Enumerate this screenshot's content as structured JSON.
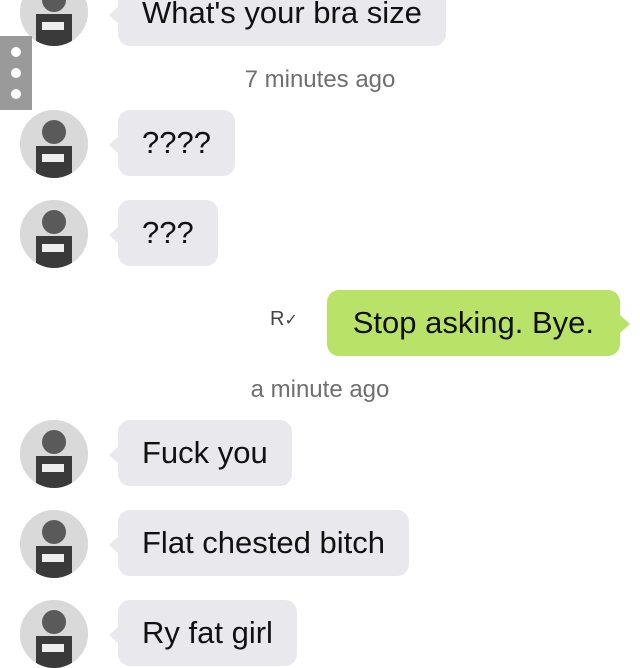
{
  "messages": [
    {
      "type": "received",
      "text": "What's your bra size"
    },
    {
      "type": "timestamp",
      "text": "7 minutes ago"
    },
    {
      "type": "received",
      "text": "????"
    },
    {
      "type": "received",
      "text": "???"
    },
    {
      "type": "sent",
      "text": "Stop asking. Bye.",
      "receipt": "R"
    },
    {
      "type": "timestamp",
      "text": "a minute ago"
    },
    {
      "type": "received",
      "text": "Fuck you"
    },
    {
      "type": "received",
      "text": "Flat chested bitch"
    },
    {
      "type": "received",
      "text": "Ry fat girl"
    }
  ],
  "colors": {
    "received_bubble": "#e8e8ed",
    "sent_bubble": "#b9e268",
    "timestamp_text": "#6f6f6f",
    "menu_tab": "#9a9a9a"
  },
  "icons": {
    "menu": "more-vertical-icon",
    "receipt": "read-receipt-icon",
    "avatar": "avatar-photo"
  }
}
